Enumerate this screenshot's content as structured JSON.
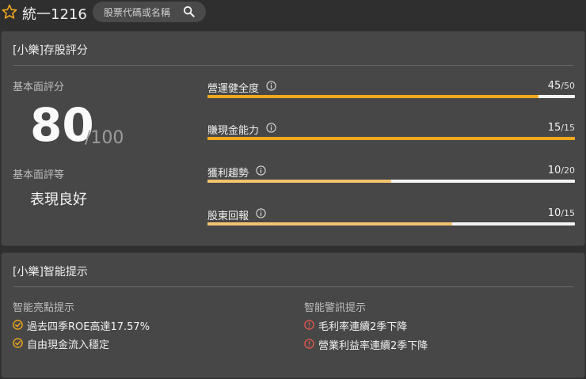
{
  "header": {
    "stock": "統一1216",
    "search_placeholder": "股票代碼或名稱"
  },
  "score_panel": {
    "title": "[小樂]存股評分",
    "score_label": "基本面評分",
    "score": "80",
    "score_max": "/100",
    "grade_label": "基本面評等",
    "grade": "表現良好",
    "metrics": [
      {
        "label": "營運健全度",
        "value": "45",
        "max": "/50",
        "ratio": 0.9
      },
      {
        "label": "賺現金能力",
        "value": "15",
        "max": "/15",
        "ratio": 1.0
      },
      {
        "label": "獲利趨勢",
        "value": "10",
        "max": "/20",
        "ratio": 0.5
      },
      {
        "label": "股東回報",
        "value": "10",
        "max": "/15",
        "ratio": 0.667
      }
    ]
  },
  "hint_panel": {
    "title": "[小樂]智能提示",
    "positive_title": "智能亮點提示",
    "positive": [
      "過去四季ROE高達17.57%",
      "自由現金流入穩定"
    ],
    "warning_title": "智能警訊提示",
    "warnings": [
      "毛利率連續2季下降",
      "營業利益率連續2季下降"
    ]
  },
  "colors": {
    "accent": "#f0a81c",
    "accent_light": "#f3c46e",
    "warning": "#e0564e"
  }
}
